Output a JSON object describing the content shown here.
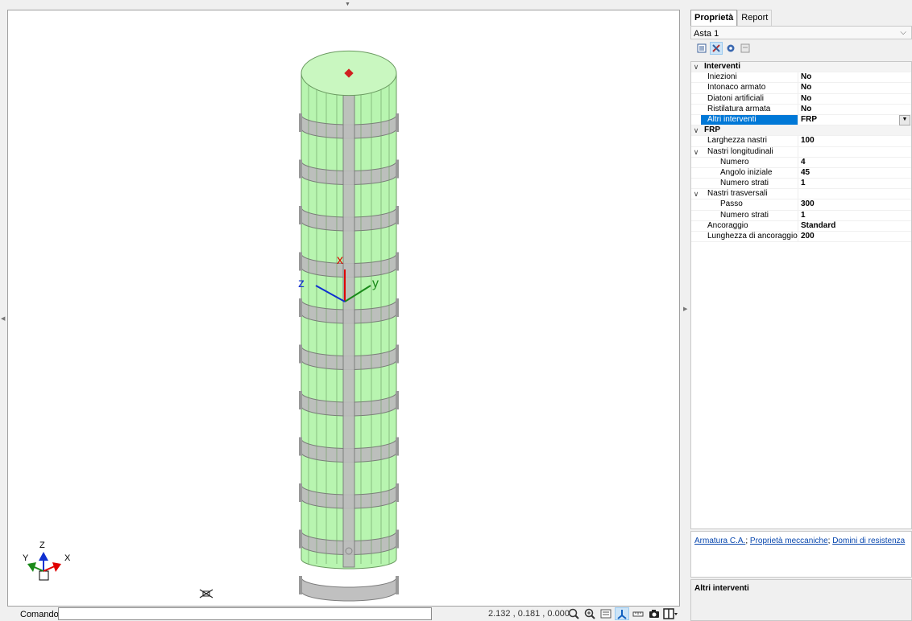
{
  "viewport": {
    "axis_labels": {
      "x": "x",
      "y": "y",
      "z": "z"
    },
    "triad": {
      "z": "Z",
      "y": "Y",
      "x": "X"
    }
  },
  "command": {
    "label": "Comando",
    "value": ""
  },
  "coordinates": "2.132 , 0.181 , 0.000",
  "panel": {
    "tabs": [
      "Proprietà",
      "Report"
    ],
    "object": "Asta 1",
    "properties": [
      {
        "type": "cat",
        "name": "Interventi",
        "value": ""
      },
      {
        "type": "row",
        "name": "Iniezioni",
        "value": "No",
        "indent": 0
      },
      {
        "type": "row",
        "name": "Intonaco armato",
        "value": "No",
        "indent": 0
      },
      {
        "type": "row",
        "name": "Diatoni artificiali",
        "value": "No",
        "indent": 0
      },
      {
        "type": "row",
        "name": "Ristilatura armata",
        "value": "No",
        "indent": 0
      },
      {
        "type": "row",
        "name": "Altri interventi",
        "value": "FRP",
        "indent": 0,
        "selected": true
      },
      {
        "type": "cat",
        "name": "FRP",
        "value": ""
      },
      {
        "type": "row",
        "name": "Larghezza nastri",
        "value": "100",
        "indent": 0
      },
      {
        "type": "group",
        "name": "Nastri longitudinali",
        "value": "",
        "indent": 0
      },
      {
        "type": "row",
        "name": "Numero",
        "value": "4",
        "indent": 1
      },
      {
        "type": "row",
        "name": "Angolo iniziale",
        "value": "45",
        "indent": 1
      },
      {
        "type": "row",
        "name": "Numero strati",
        "value": "1",
        "indent": 1
      },
      {
        "type": "group",
        "name": "Nastri trasversali",
        "value": "",
        "indent": 0
      },
      {
        "type": "row",
        "name": "Passo",
        "value": "300",
        "indent": 1
      },
      {
        "type": "row",
        "name": "Numero strati",
        "value": "1",
        "indent": 1
      },
      {
        "type": "row",
        "name": "Ancoraggio",
        "value": "Standard",
        "indent": 0
      },
      {
        "type": "row",
        "name": "Lunghezza di ancoraggio",
        "value": "200",
        "indent": 0
      }
    ],
    "links": [
      "Armatura C.A.",
      "Proprietà meccaniche",
      "Domini di resistenza"
    ],
    "description_title": "Altri interventi"
  },
  "colors": {
    "cylinder_fill": "#b8f5b0",
    "band_fill": "#bdbdbd",
    "selection": "#0078d7",
    "axis_x": "#e00000",
    "axis_y": "#1a8a1a",
    "axis_z": "#1030d0"
  }
}
